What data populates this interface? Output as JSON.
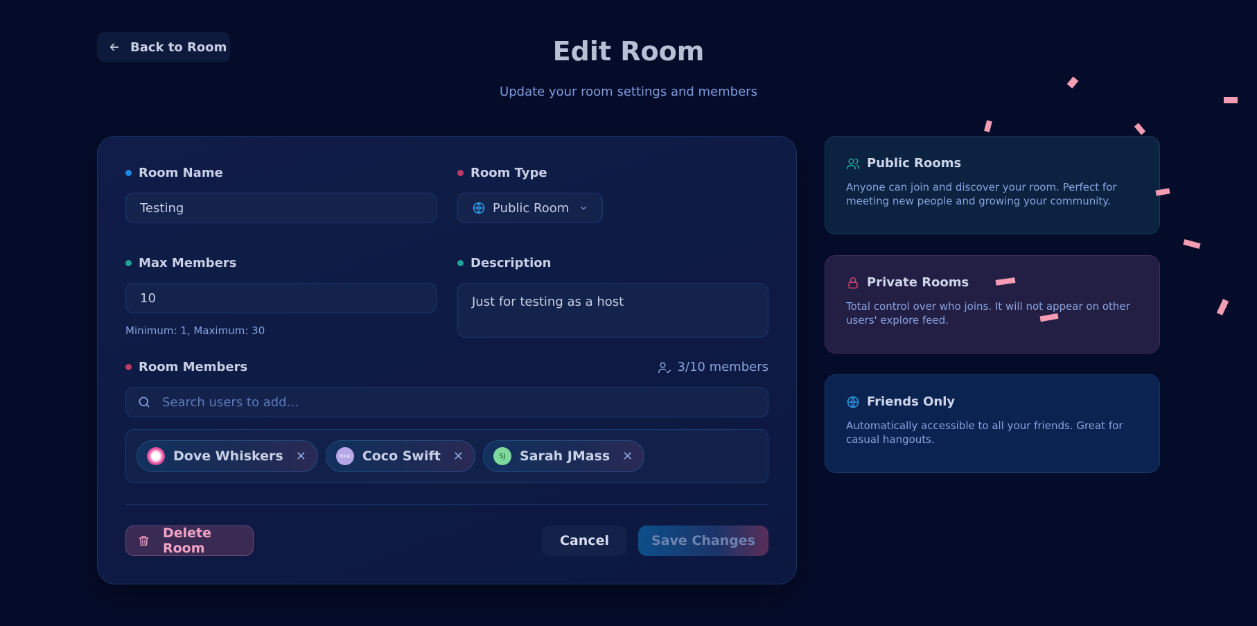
{
  "back": {
    "label": "Back to Room"
  },
  "header": {
    "title": "Edit Room",
    "subtitle": "Update your room settings and members"
  },
  "form": {
    "room_name": {
      "label": "Room Name",
      "value": "Testing"
    },
    "room_type": {
      "label": "Room Type",
      "value": "Public Room"
    },
    "max_members": {
      "label": "Max Members",
      "value": "10",
      "hint": "Minimum: 1, Maximum: 30"
    },
    "description": {
      "label": "Description",
      "value": "Just for testing as a host"
    },
    "members": {
      "label": "Room Members",
      "count": "3/10 members",
      "search_placeholder": "Search users to add...",
      "list": [
        {
          "name": "Dove Whiskers"
        },
        {
          "name": "Coco Swift",
          "avatar_text": "Brink"
        },
        {
          "name": "Sarah JMass",
          "avatar_text": "SJ"
        }
      ]
    }
  },
  "actions": {
    "delete": "Delete Room",
    "cancel": "Cancel",
    "save": "Save Changes"
  },
  "info": [
    {
      "title": "Public Rooms",
      "desc": "Anyone can join and discover your room. Perfect for meeting new people and growing your community."
    },
    {
      "title": "Private Rooms",
      "desc": "Total control over who joins. It will not appear on other users' explore feed."
    },
    {
      "title": "Friends Only",
      "desc": "Automatically accessible to all your friends. Great for casual hangouts."
    }
  ],
  "colors": {
    "background": "#050c29",
    "accent_blue": "#1b8ae6",
    "accent_pink": "#c03a66",
    "accent_teal": "#1fa39b",
    "confetti": "#f39cb4"
  }
}
